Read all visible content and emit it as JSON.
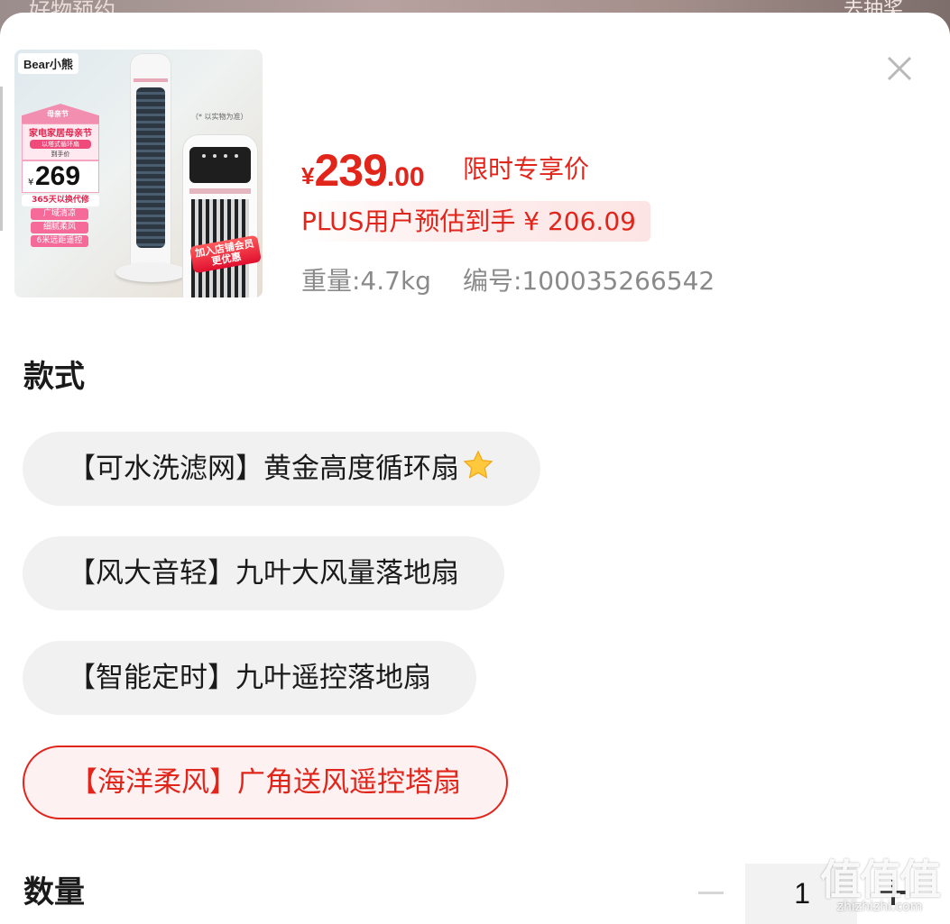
{
  "backdrop": {
    "left_text": "好物预约",
    "right_text": "去抽奖"
  },
  "product": {
    "image": {
      "brand_logo": "Bear小熊",
      "note": "（* 以实物为准）",
      "festival_house": "母亲节",
      "festival_title": "家电家居母亲节",
      "festival_sub": "以塔式循环扇",
      "festival_caption": "到手价",
      "image_price_currency": "¥",
      "image_price": "269",
      "tag_service": "365天以换代修",
      "tags": [
        "广域清凉",
        "细腻柔风",
        "6米远距遥控"
      ],
      "member_promo_line1": "加入店铺会员",
      "member_promo_line2": "更优惠"
    },
    "price": {
      "currency": "¥",
      "integer": "239",
      "decimal": ".00",
      "label": "限时专享价"
    },
    "plus_price": "PLUS用户预估到手 ¥ 206.09",
    "weight": "重量:4.7kg",
    "sku": "编号:100035266542"
  },
  "style_section": {
    "title": "款式",
    "options": [
      {
        "label": "【可水洗滤网】黄金高度循环扇",
        "selected": false,
        "has_star": true
      },
      {
        "label": "【风大音轻】九叶大风量落地扇",
        "selected": false,
        "has_star": false
      },
      {
        "label": "【智能定时】九叶遥控落地扇",
        "selected": false,
        "has_star": false
      },
      {
        "label": "【海洋柔风】广角送风遥控塔扇",
        "selected": true,
        "has_star": false
      }
    ]
  },
  "quantity_section": {
    "title": "数量",
    "value": "1"
  },
  "watermark": {
    "chars": "值值值",
    "url": "zhizhizhi.com"
  },
  "colors": {
    "accent": "#e1251b",
    "option_bg": "#f1f1f1",
    "selected_bg": "#fdf1f1",
    "meta_text": "#8a8a8a"
  }
}
